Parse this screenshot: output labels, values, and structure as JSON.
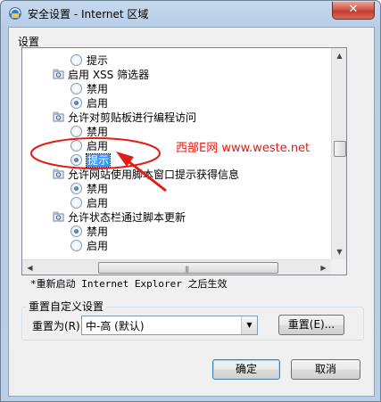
{
  "window": {
    "title": "安全设置 - Internet 区域",
    "close_symbol": "✕"
  },
  "settings_label": "设置",
  "tree": {
    "rows": [
      {
        "type": "radio",
        "label": "提示",
        "checked": false,
        "indent": 1,
        "selected": false
      },
      {
        "type": "group",
        "label": "启用 XSS 筛选器"
      },
      {
        "type": "radio",
        "label": "禁用",
        "checked": false,
        "indent": 1,
        "selected": false
      },
      {
        "type": "radio",
        "label": "启用",
        "checked": true,
        "indent": 1,
        "selected": false
      },
      {
        "type": "group",
        "label": "允许对剪贴板进行编程访问"
      },
      {
        "type": "radio",
        "label": "禁用",
        "checked": false,
        "indent": 1,
        "selected": false
      },
      {
        "type": "radio",
        "label": "启用",
        "checked": false,
        "indent": 1,
        "selected": false
      },
      {
        "type": "radio",
        "label": "提示",
        "checked": true,
        "indent": 1,
        "selected": true
      },
      {
        "type": "group",
        "label": "允许网站使用脚本窗口提示获得信息"
      },
      {
        "type": "radio",
        "label": "禁用",
        "checked": true,
        "indent": 1,
        "selected": false
      },
      {
        "type": "radio",
        "label": "启用",
        "checked": false,
        "indent": 1,
        "selected": false
      },
      {
        "type": "group",
        "label": "允许状态栏通过脚本更新"
      },
      {
        "type": "radio",
        "label": "禁用",
        "checked": true,
        "indent": 1,
        "selected": false
      },
      {
        "type": "radio",
        "label": "启用",
        "checked": false,
        "indent": 1,
        "selected": false
      }
    ]
  },
  "watermark": "西部E网  www.weste.net",
  "note": "*重新启动 Internet Explorer 之后生效",
  "reset_group": {
    "label": "重置自定义设置",
    "reset_to_label": "重置为(R):",
    "select_value": "中-高 (默认)",
    "reset_button": "重置(E)..."
  },
  "buttons": {
    "ok": "确定",
    "cancel": "取消"
  },
  "icons": {
    "window": "shield-icon",
    "group": "gear-icon"
  },
  "colors": {
    "annotation": "#e41b13",
    "selection": "#3399ff"
  }
}
